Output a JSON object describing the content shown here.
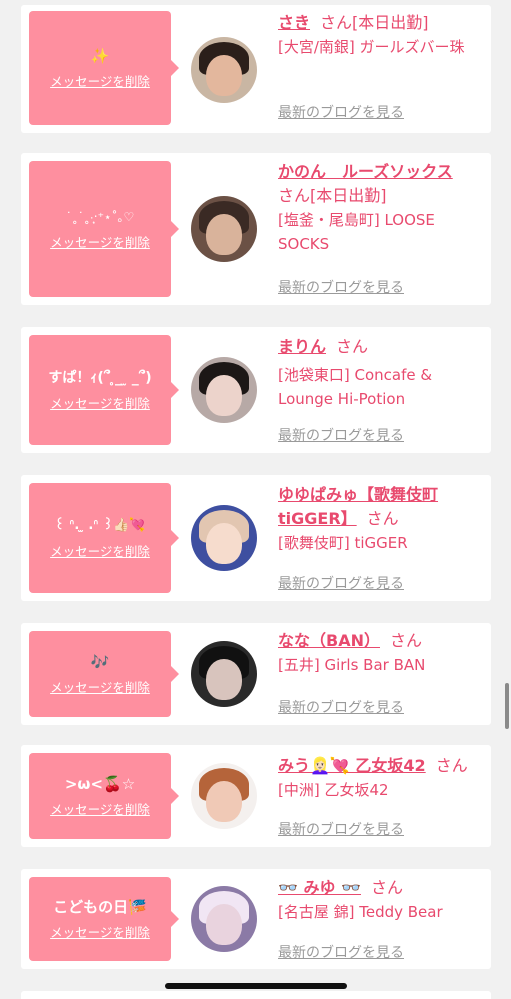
{
  "delete_label": "メッセージを削除",
  "blog_label": "最新のブログを見る",
  "san_label": "さん",
  "cards": [
    {
      "message": "✨",
      "name": "さき",
      "suffix": "[本日出勤]",
      "shop": "[大宮/南銀] ガールズバー珠",
      "avatar_colors": {
        "bg": "#c9b6a3",
        "hair": "#2b1f1a",
        "face": "#e3b79d"
      }
    },
    {
      "message": "˙˳˙˳·̩͙‧⁺⋆˚｡♡",
      "name": "かのん　ルーズソックス",
      "suffix": "さん[本日出勤]",
      "shop": "[塩釜・尾島町] LOOSE SOCKS",
      "avatar_colors": {
        "bg": "#6b5145",
        "hair": "#3a2a24",
        "face": "#d9b39b"
      }
    },
    {
      "message": "すぱ！ｨ(՞ ̥_ ̫ _՞)",
      "name": "まりん",
      "suffix": "",
      "shop": "[池袋東口] Concafe & Lounge Hi-Potion",
      "avatar_colors": {
        "bg": "#b7a9a6",
        "hair": "#1c1716",
        "face": "#ecd3cb"
      }
    },
    {
      "message": "꒰ ᐢ. ̫ .ᐢ ꒱👍🏻💘",
      "name": "ゆゆぱみゅ【歌舞伎町tiGGER】",
      "suffix": "",
      "shop": "[歌舞伎町] tiGGER",
      "avatar_colors": {
        "bg": "#3e4fa0",
        "hair": "#e2c6b1",
        "face": "#f6dccd"
      }
    },
    {
      "message": "🎶",
      "name": "なな（BAN）",
      "suffix": "",
      "shop": "[五井] Girls Bar BAN",
      "avatar_colors": {
        "bg": "#2a2a2a",
        "hair": "#111111",
        "face": "#d8c4bd"
      }
    },
    {
      "message": ">ω<🍒☆",
      "name": "みう👱🏻‍♀️💘 乙女坂42",
      "suffix": "",
      "shop": "[中洲] 乙女坂42",
      "avatar_colors": {
        "bg": "#f4f0ee",
        "hair": "#b5643a",
        "face": "#f0c9b6"
      }
    },
    {
      "message": "こどもの日🎏",
      "name": "👓 みゆ 👓",
      "suffix": "",
      "shop": "[名古屋 錦] Teddy Bear",
      "avatar_colors": {
        "bg": "#8b7aa6",
        "hair": "#f1e6f4",
        "face": "#e9d3de"
      }
    }
  ]
}
